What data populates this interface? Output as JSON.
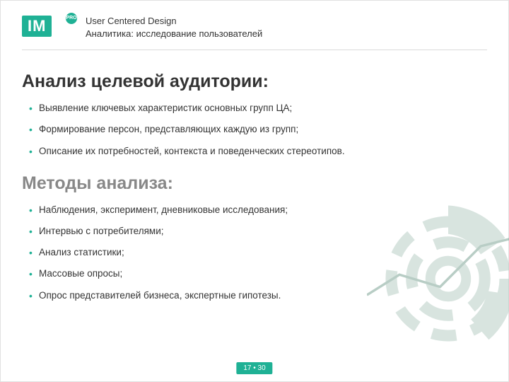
{
  "logo": {
    "text": "IM",
    "badge": "PRO"
  },
  "header": {
    "line1": "User Centered Design",
    "line2": "Аналитика: исследование пользователей"
  },
  "section1": {
    "title": "Анализ целевой аудитории:",
    "items": [
      "Выявление ключевых характеристик основных групп ЦА;",
      "Формирование персон, представляющих каждую из групп;",
      "Описание их потребностей, контекста и поведенческих стереотипов."
    ]
  },
  "section2": {
    "title": "Методы анализа:",
    "items": [
      "Наблюдения, эксперимент, дневниковые исследования;",
      "Интервью с потребителями;",
      "Анализ статистики;",
      "Массовые опросы;",
      "Опрос представителей бизнеса, экспертные гипотезы."
    ]
  },
  "pager": {
    "current": "17",
    "sep": "•",
    "total": "30"
  },
  "colors": {
    "accent": "#1fb195"
  }
}
